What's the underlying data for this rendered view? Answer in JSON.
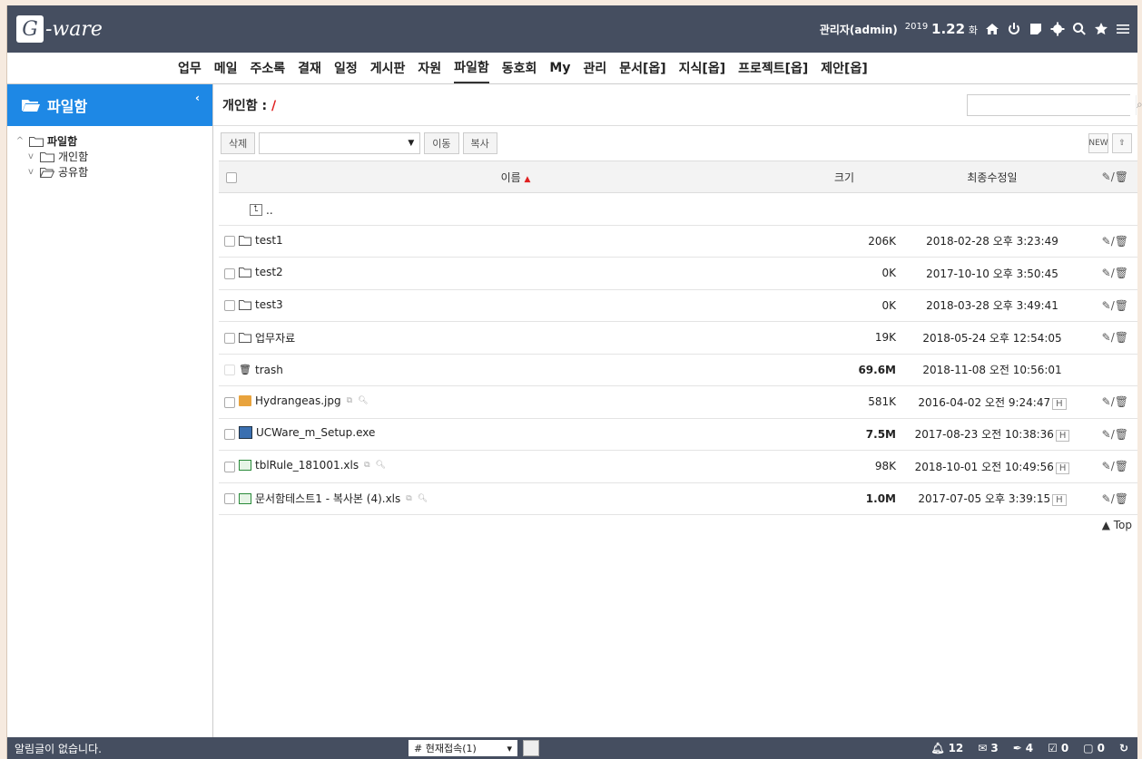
{
  "header": {
    "logo": "G-ware",
    "user": "관리자(admin)",
    "year": "2019",
    "date": "1.22",
    "weekday": "화"
  },
  "menu": {
    "items": [
      "업무",
      "메일",
      "주소록",
      "결재",
      "일정",
      "게시판",
      "자원",
      "파일함",
      "동호회",
      "My",
      "관리",
      "문서[옵]",
      "지식[옵]",
      "프로젝트[옵]",
      "제안[옵]"
    ],
    "active": "파일함"
  },
  "sidebar": {
    "title": "파일함",
    "tree": {
      "root": "파일함",
      "children": [
        "개인함",
        "공유함"
      ]
    }
  },
  "content": {
    "title": "개인함 :",
    "path": "/",
    "search_placeholder": "",
    "toolbar": {
      "delete": "삭제",
      "move": "이동",
      "copy": "복사",
      "new_icon": "NEW"
    },
    "columns": {
      "name": "이름",
      "size": "크기",
      "modified": "최종수정일"
    },
    "up_label": "..",
    "rows": [
      {
        "name": "test1",
        "type": "folder",
        "size": "206K",
        "modified": "2018-02-28 오후 3:23:49"
      },
      {
        "name": "test2",
        "type": "folder",
        "size": "0K",
        "modified": "2017-10-10 오후 3:50:45"
      },
      {
        "name": "test3",
        "type": "folder",
        "size": "0K",
        "modified": "2018-03-28 오후 3:49:41"
      },
      {
        "name": "업무자료",
        "type": "folder",
        "size": "19K",
        "modified": "2018-05-24 오후 12:54:05"
      },
      {
        "name": "trash",
        "type": "trash",
        "size": "69.6M",
        "modified": "2018-11-08 오전 10:56:01"
      },
      {
        "name": "Hydrangeas.jpg",
        "type": "jpg",
        "size": "581K",
        "modified": "2016-04-02 오전 9:24:47"
      },
      {
        "name": "UCWare_m_Setup.exe",
        "type": "exe",
        "size": "7.5M",
        "modified": "2017-08-23 오전 10:38:36"
      },
      {
        "name": "tblRule_181001.xls",
        "type": "xls",
        "size": "98K",
        "modified": "2018-10-01 오전 10:49:56"
      },
      {
        "name": "문서함테스트1 - 복사본 (4).xls",
        "type": "xls",
        "size": "1.0M",
        "modified": "2017-07-05 오후 3:39:15"
      }
    ],
    "h_label": "H",
    "top_link": "▲ Top"
  },
  "footer": {
    "notice": "알림글이 없습니다.",
    "connected": "# 현재접속(1)",
    "counts": {
      "alerts": "12",
      "mail": "3",
      "approvals": "4",
      "schedule": "0",
      "messages": "0"
    }
  }
}
